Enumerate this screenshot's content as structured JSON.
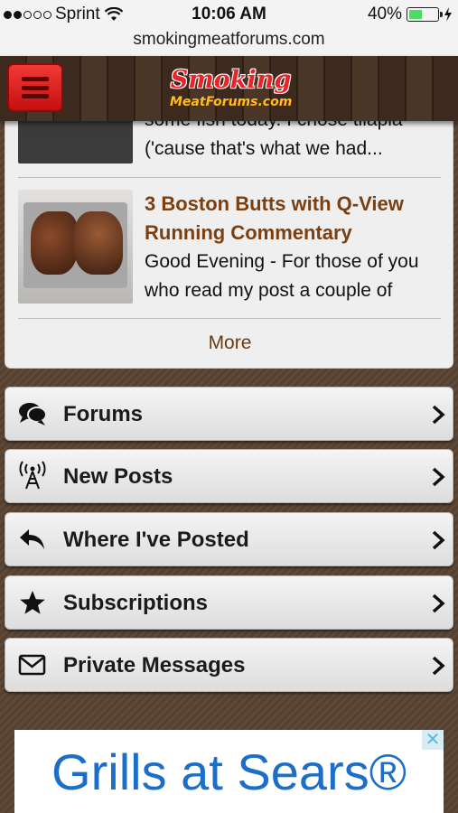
{
  "status_bar": {
    "carrier": "Sprint",
    "time": "10:06 AM",
    "battery_percent": "40%",
    "battery_level": 0.4,
    "signal_bars": 2
  },
  "browser": {
    "url": "smokingmeatforums.com"
  },
  "header": {
    "logo_line1": "Smoking",
    "logo_line2": "MeatForums.com"
  },
  "posts": [
    {
      "title": "",
      "excerpt_line1": "some fish today.  I chose tilapia",
      "excerpt_line2": "('cause that's what we had..."
    },
    {
      "title_line1": "3 Boston Butts with Q-View",
      "title_line2": "Running Commentary",
      "excerpt_line1": "Good Evening - For those of you",
      "excerpt_line2": "who read my post a couple of"
    }
  ],
  "more_label": "More",
  "nav": [
    {
      "label": "Forums",
      "icon": "chat-bubbles-icon"
    },
    {
      "label": "New Posts",
      "icon": "broadcast-tower-icon"
    },
    {
      "label": "Where I've Posted",
      "icon": "reply-arrow-icon"
    },
    {
      "label": "Subscriptions",
      "icon": "star-icon"
    },
    {
      "label": "Private Messages",
      "icon": "envelope-icon"
    }
  ],
  "ad": {
    "text": "Grills at Sears®",
    "close": "✕"
  }
}
